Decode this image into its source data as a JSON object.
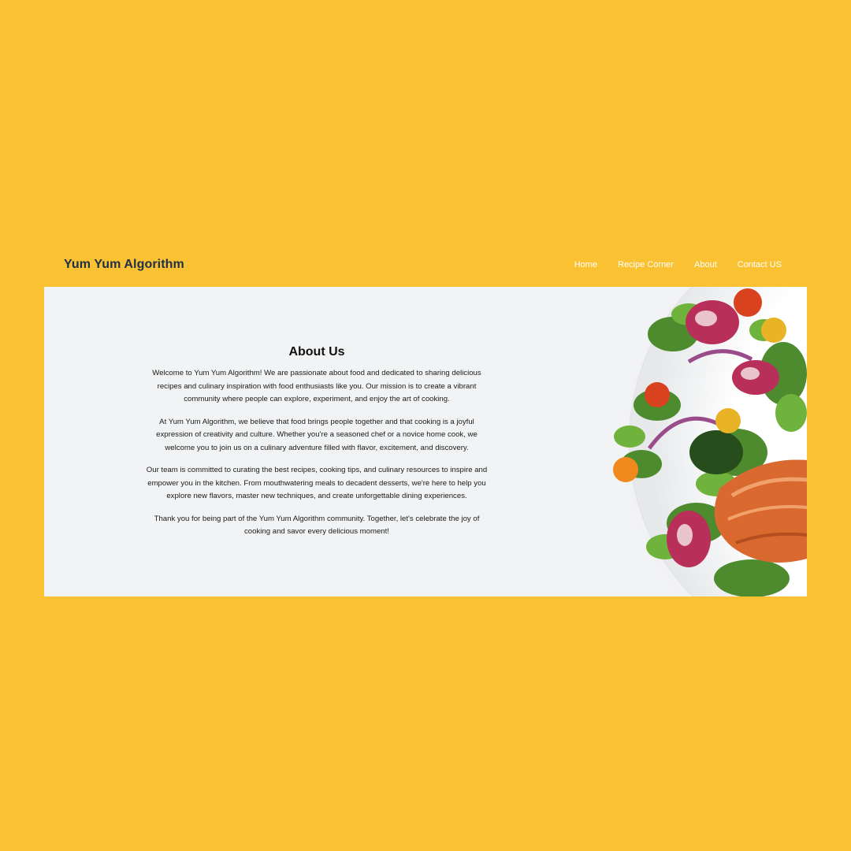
{
  "header": {
    "brand": "Yum Yum Algorithm",
    "nav": [
      "Home",
      "Recipe Corner",
      "About",
      "Contact US"
    ]
  },
  "about": {
    "title": "About Us",
    "paragraphs": [
      "Welcome to Yum Yum Algorithm! We are passionate about food and dedicated to sharing delicious recipes and culinary inspiration with food enthusiasts like you. Our mission is to create a vibrant community where people can explore, experiment, and enjoy the art of cooking.",
      "At Yum Yum Algorithm, we believe that food brings people together and that cooking is a joyful expression of creativity and culture. Whether you're a seasoned chef or a novice home cook, we welcome you to join us on a culinary adventure filled with flavor, excitement, and discovery.",
      "Our team is committed to curating the best recipes, cooking tips, and culinary resources to inspire and empower you in the kitchen. From mouthwatering meals to decadent desserts, we're here to help you explore new flavors, master new techniques, and create unforgettable dining experiences.",
      "Thank you for being part of the Yum Yum Algorithm community. Together, let's celebrate the joy of cooking and savor every delicious moment!"
    ]
  },
  "colors": {
    "background": "#FAC232",
    "panel": "#f2f3f4",
    "brand_text": "#1f2f4a",
    "nav_text": "#ffffff"
  }
}
